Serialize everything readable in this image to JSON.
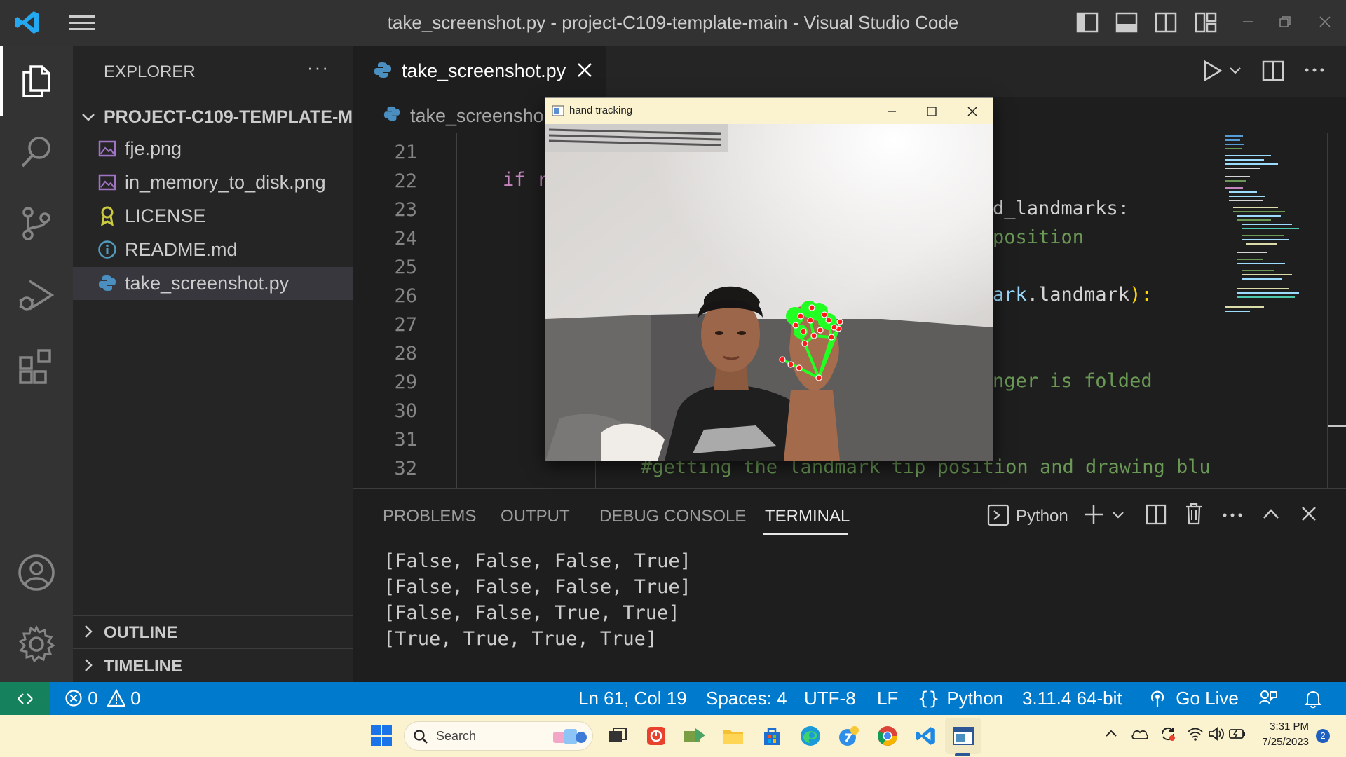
{
  "window": {
    "title": "take_screenshot.py - project-C109-template-main - Visual Studio Code"
  },
  "activity_bar": {
    "items": [
      "explorer-icon",
      "search-icon",
      "source-control-icon",
      "run-debug-icon",
      "extensions-icon"
    ],
    "bottom": [
      "account-icon",
      "settings-gear-icon"
    ]
  },
  "sidebar": {
    "header": "EXPLORER",
    "more": "···",
    "project": "PROJECT-C109-TEMPLATE-M...",
    "files": [
      {
        "name": "fje.png",
        "icon": "image-icon"
      },
      {
        "name": "in_memory_to_disk.png",
        "icon": "image-icon"
      },
      {
        "name": "LICENSE",
        "icon": "license-icon"
      },
      {
        "name": "README.md",
        "icon": "info-icon"
      },
      {
        "name": "take_screenshot.py",
        "icon": "python-icon",
        "selected": true
      }
    ],
    "outline": "OUTLINE",
    "timeline": "TIMELINE"
  },
  "editor": {
    "tab": "take_screenshot.py",
    "breadcrumb": "take_screensho",
    "line_numbers": [
      "21",
      "22",
      "23",
      "24",
      "25",
      "26",
      "27",
      "28",
      "29",
      "30",
      "31",
      "32"
    ],
    "code": {
      "l22_kw": "if r",
      "l23": "d_landmarks:",
      "l24": "position",
      "l26_a": "ark",
      "l26_b": ".landmark",
      "l26_c": "):",
      "l29": "nger is folded",
      "l32": "#getting the landmark tip position and drawing blu"
    }
  },
  "panel": {
    "tabs": [
      "PROBLEMS",
      "OUTPUT",
      "DEBUG CONSOLE",
      "TERMINAL"
    ],
    "active_tab": "TERMINAL",
    "terminal_profile": "Python",
    "terminal_lines": [
      "[False, False, False, True]",
      "[False, False, False, True]",
      "[False, False, True, True]",
      "[True, True, True, True]"
    ]
  },
  "status_bar": {
    "errors": "0",
    "warnings": "0",
    "position": "Ln 61, Col 19",
    "spaces": "Spaces: 4",
    "encoding": "UTF-8",
    "eol": "LF",
    "language": "Python",
    "interpreter": "3.11.4 64-bit",
    "go_live": "Go Live"
  },
  "hand_tracking": {
    "title": "hand tracking"
  },
  "taskbar": {
    "search_placeholder": "Search",
    "time": "3:31 PM",
    "date": "7/25/2023",
    "notification_count": "2"
  },
  "colors": {
    "accent": "#007acc",
    "keyword": "#c586c0",
    "comment": "#6a9955",
    "function": "#dcdcaa",
    "bracket": "#ffd700"
  }
}
